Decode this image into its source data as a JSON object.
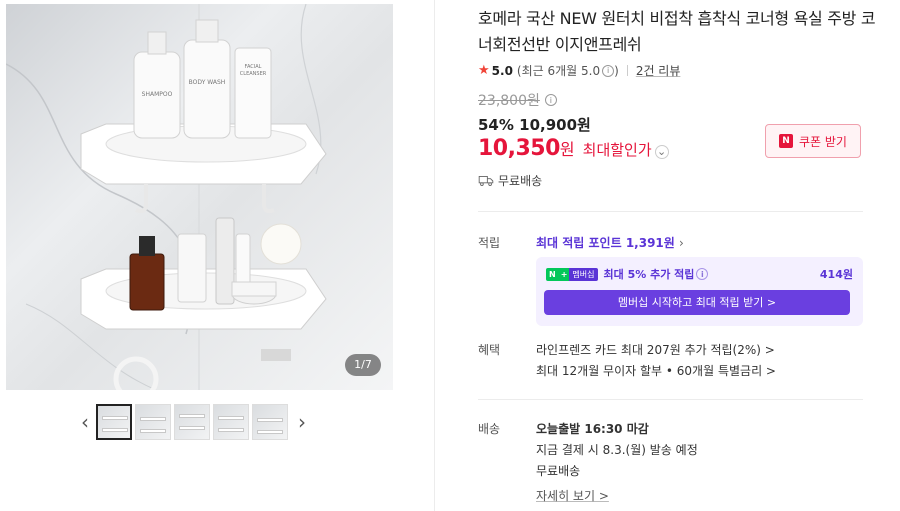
{
  "gallery": {
    "counter": "1/7",
    "prev_arrow": "‹",
    "next_arrow": "›",
    "thumbnail_count": 5,
    "bottles": {
      "shampoo": "SHAMPOO",
      "body_wash": "BODY WASH",
      "facial_cleanser_line1": "FACIAL",
      "facial_cleanser_line2": "CLEANSER"
    }
  },
  "product": {
    "title": "호메라 국산 NEW 원터치 비접착 흡착식 코너형 욕실 주방 코너회전선반 이지앤프레쉬",
    "rating_score": "5.0",
    "rating_recent": "(최근 6개월 5.0",
    "rating_recent_close": ")",
    "review_count": "2건 리뷰",
    "original_price": "23,800원",
    "discount_line": "54% 10,900원",
    "final_price": "10,350",
    "final_won": "원",
    "final_label": "최대할인가",
    "coupon_button": "쿠폰 받기",
    "coupon_badge": "N",
    "shipping_free": "무료배송"
  },
  "points": {
    "label": "적립",
    "link": "최대 적립 포인트 1,391원",
    "membership_badge_n": "N",
    "membership_badge_plus": "+",
    "membership_badge_text": "멤버십",
    "membership_text": "최대 5% 추가 적립",
    "membership_amount": "414원",
    "membership_button": "멤버십 시작하고 최대 적립 받기 >"
  },
  "benefits": {
    "label": "혜택",
    "line1": "라인프렌즈 카드 최대 207원 추가 적립(2%) >",
    "line2": "최대 12개월 무이자 할부 • 60개월 특별금리 >"
  },
  "delivery": {
    "label": "배송",
    "line1": "오늘출발 16:30 마감",
    "line2": "지금 결제 시 8.3.(월) 발송 예정",
    "line3": "무료배송",
    "detail_link": "자세히 보기 >"
  },
  "colors": {
    "accent_red": "#e5153b",
    "accent_purple": "#5a34d6",
    "star_red": "#f04438",
    "naver_green": "#03c75a"
  }
}
